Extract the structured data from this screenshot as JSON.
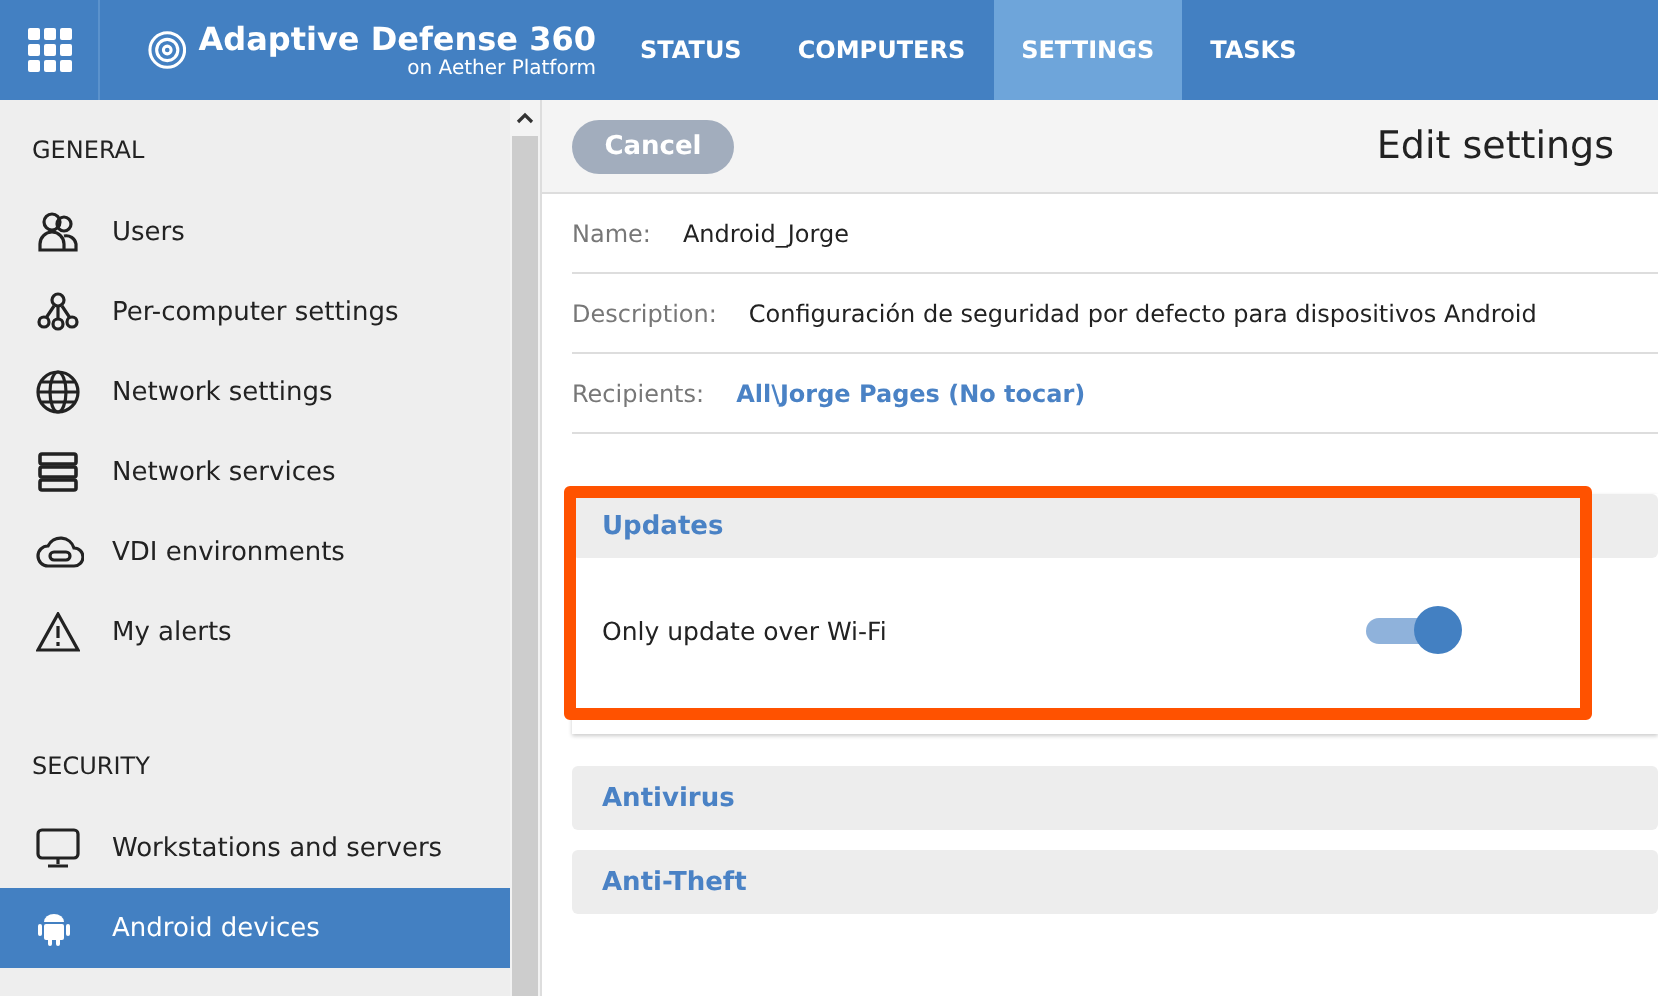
{
  "header": {
    "product": "Adaptive Defense 360",
    "subtitle": "on Aether Platform",
    "tabs": [
      {
        "label": "STATUS",
        "selected": false
      },
      {
        "label": "COMPUTERS",
        "selected": false
      },
      {
        "label": "SETTINGS",
        "selected": true
      },
      {
        "label": "TASKS",
        "selected": false
      }
    ]
  },
  "sidebar": {
    "sections": [
      {
        "title": "GENERAL",
        "items": [
          {
            "label": "Users",
            "kind": "users",
            "selected": false
          },
          {
            "label": "Per-computer settings",
            "kind": "nodes",
            "selected": false
          },
          {
            "label": "Network settings",
            "kind": "globe",
            "selected": false
          },
          {
            "label": "Network services",
            "kind": "server",
            "selected": false
          },
          {
            "label": "VDI environments",
            "kind": "cloud",
            "selected": false
          },
          {
            "label": "My alerts",
            "kind": "alert",
            "selected": false
          }
        ]
      },
      {
        "title": "SECURITY",
        "items": [
          {
            "label": "Workstations and servers",
            "kind": "monitor",
            "selected": false
          },
          {
            "label": "Android devices",
            "kind": "android",
            "selected": true
          }
        ]
      }
    ]
  },
  "toolbar": {
    "cancel": "Cancel",
    "title": "Edit settings"
  },
  "fields": [
    {
      "label": "Name:",
      "value": "Android_Jorge",
      "kind": "text"
    },
    {
      "label": "Description:",
      "value": "Configuración de seguridad por defecto para dispositivos Android",
      "kind": "text"
    },
    {
      "label": "Recipients:",
      "value": "All\\Jorge Pages (No tocar)",
      "kind": "link"
    }
  ],
  "panels": [
    {
      "title": "Updates",
      "expanded": true,
      "options": [
        {
          "label": "Only update over Wi-Fi",
          "on": true
        }
      ]
    },
    {
      "title": "Antivirus",
      "expanded": false
    },
    {
      "title": "Anti-Theft",
      "expanded": false
    }
  ]
}
